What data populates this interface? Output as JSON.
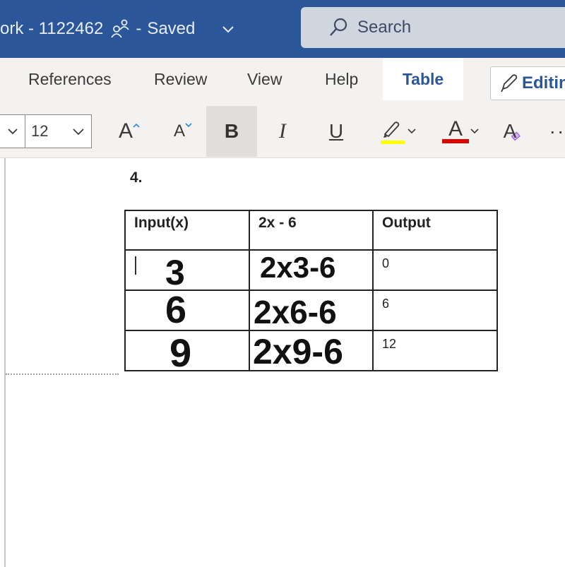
{
  "titlebar": {
    "doc_title": "ork - 1122462",
    "separator": "-",
    "save_status": "Saved",
    "shared_icon": "people-icon",
    "chevron_icon": "chevron-down-icon",
    "background": "#2b579a"
  },
  "search": {
    "placeholder": "Search",
    "icon": "search-icon"
  },
  "ribbon_tabs": [
    {
      "label": "References",
      "active": false
    },
    {
      "label": "Review",
      "active": false
    },
    {
      "label": "View",
      "active": false
    },
    {
      "label": "Help",
      "active": false
    },
    {
      "label": "Table",
      "active": true
    }
  ],
  "editing_button": {
    "label": "Editing",
    "icon": "pencil-icon"
  },
  "toolbar": {
    "font_size": "12",
    "grow_font_label": "A",
    "shrink_font_label": "A",
    "bold_label": "B",
    "italic_label": "I",
    "underline_label": "U",
    "font_color_label": "A",
    "clear_format_label": "A",
    "more_label": "··",
    "highlight_color": "#ffff00",
    "font_color": "#e00000",
    "eraser_color": "#b47ee0"
  },
  "document": {
    "question_number": "4.",
    "table": {
      "headers": [
        "Input(x)",
        "2x - 6",
        "Output"
      ],
      "rows": [
        {
          "input": "3",
          "expression": "2x3-6",
          "output": "0"
        },
        {
          "input": "6",
          "expression": "2x6-6",
          "output": "6"
        },
        {
          "input": "9",
          "expression": "2x9-6",
          "output": "12"
        }
      ]
    }
  }
}
